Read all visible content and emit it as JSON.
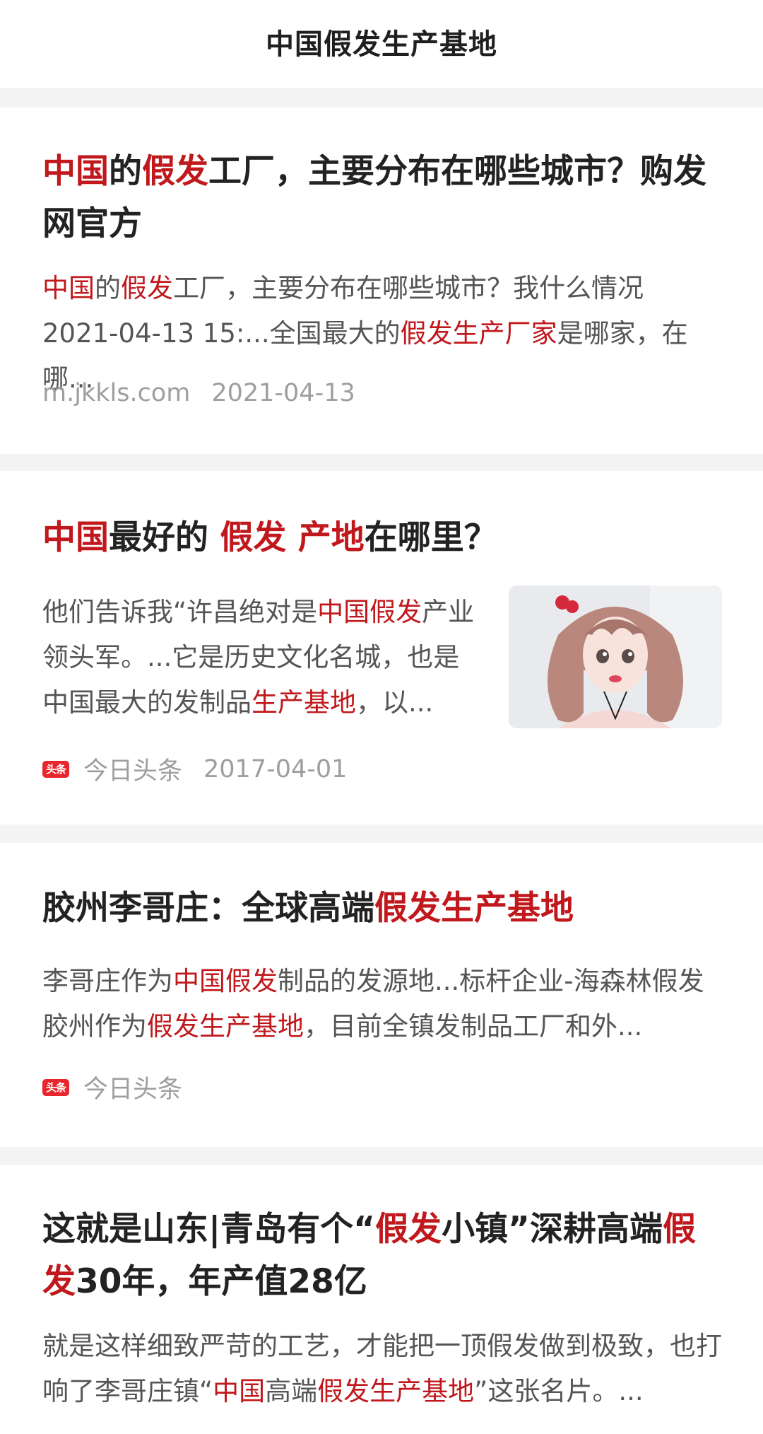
{
  "header": {
    "title": "中国假发生产基地"
  },
  "results": [
    {
      "title_parts": [
        {
          "t": "中国",
          "hl": true
        },
        {
          "t": "的",
          "hl": false
        },
        {
          "t": "假发",
          "hl": true
        },
        {
          "t": "工厂，主要分布在哪些城市？购发网官方",
          "hl": false
        }
      ],
      "snippet_parts": [
        {
          "t": "中国",
          "hl": true
        },
        {
          "t": "的",
          "hl": false
        },
        {
          "t": "假发",
          "hl": true
        },
        {
          "t": "工厂，主要分布在哪些城市？我什么情况 2021-04-13 15:...全国最大的",
          "hl": false
        },
        {
          "t": "假发生产厂家",
          "hl": true
        },
        {
          "t": "是哪家，在哪...",
          "hl": false
        }
      ],
      "source": "m.jkkls.com",
      "date": "2021-04-13"
    },
    {
      "title_parts": [
        {
          "t": "中国",
          "hl": true
        },
        {
          "t": "最好的 ",
          "hl": false
        },
        {
          "t": "假发 产地",
          "hl": true
        },
        {
          "t": "在哪里？",
          "hl": false
        }
      ],
      "snippet_parts": [
        {
          "t": "他们告诉我“许昌绝对是",
          "hl": false
        },
        {
          "t": "中国假发",
          "hl": true
        },
        {
          "t": "产业领头军。...它是历史文化名城，也是中国最大的发制品",
          "hl": false
        },
        {
          "t": "生产基地",
          "hl": true
        },
        {
          "t": "，以...",
          "hl": false
        }
      ],
      "source_badge": "头条",
      "source": "今日头条",
      "date": "2017-04-01",
      "thumbnail_icon": "doll-wig-photo"
    },
    {
      "title_parts": [
        {
          "t": "胶州李哥庄：全球高端",
          "hl": false
        },
        {
          "t": "假发生产基地",
          "hl": true
        }
      ],
      "snippet_parts": [
        {
          "t": "李哥庄作为",
          "hl": false
        },
        {
          "t": "中国假发",
          "hl": true
        },
        {
          "t": "制品的发源地...标杆企业-海森林假发 胶州作为",
          "hl": false
        },
        {
          "t": "假发生产基地",
          "hl": true
        },
        {
          "t": "，目前全镇发制品工厂和外...",
          "hl": false
        }
      ],
      "source_badge": "头条",
      "source": "今日头条"
    },
    {
      "title_parts": [
        {
          "t": "这就是山东|青岛有个“",
          "hl": false
        },
        {
          "t": "假发",
          "hl": true
        },
        {
          "t": "小镇”深耕高端",
          "hl": false
        },
        {
          "t": "假发",
          "hl": true
        },
        {
          "t": "30年，年产值28亿",
          "hl": false
        }
      ],
      "snippet_parts": [
        {
          "t": "就是这样细致严苛的工艺，才能把一顶假发做到极致，也打响了李哥庄镇“",
          "hl": false
        },
        {
          "t": "中国",
          "hl": true
        },
        {
          "t": "高端",
          "hl": false
        },
        {
          "t": "假发生产基地",
          "hl": true
        },
        {
          "t": "”这张名片。...",
          "hl": false
        }
      ]
    }
  ],
  "colors": {
    "highlight": "#c0181c",
    "badge": "#e8262d"
  }
}
